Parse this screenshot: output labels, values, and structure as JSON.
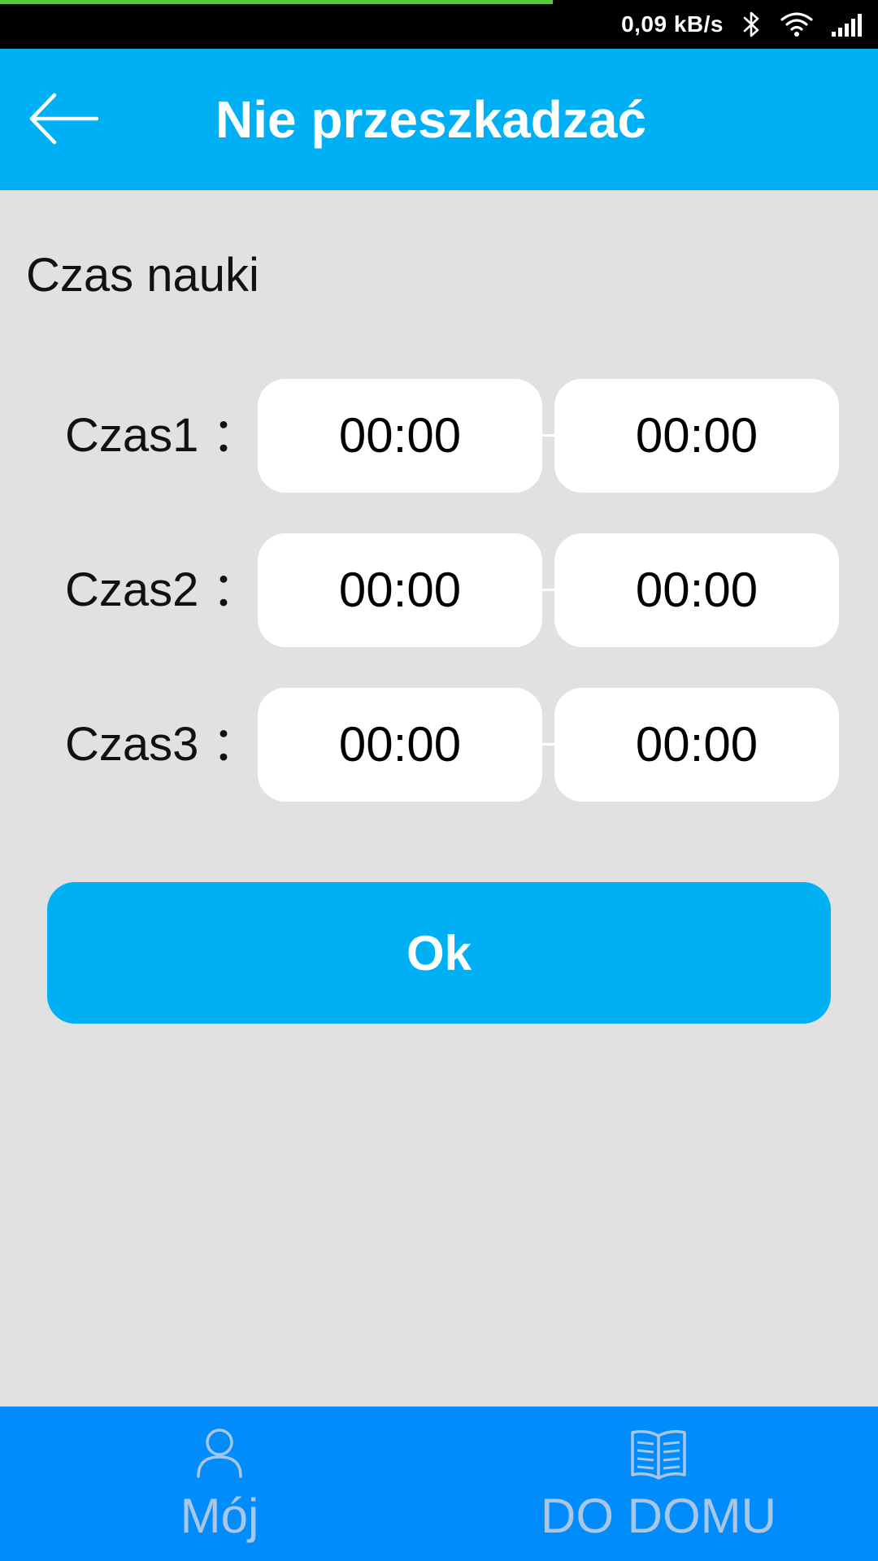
{
  "status_bar": {
    "net_speed": "0,09 kB/s",
    "progress": 0.63
  },
  "app_bar": {
    "title": "Nie przeszkadzać"
  },
  "section": {
    "title": "Czas nauki"
  },
  "time_slots": [
    {
      "label": "Czas1 ：",
      "start": "00:00",
      "end": "00:00"
    },
    {
      "label": "Czas2 ：",
      "start": "00:00",
      "end": "00:00"
    },
    {
      "label": "Czas3 ：",
      "start": "00:00",
      "end": "00:00"
    }
  ],
  "ok_button": {
    "label": "Ok"
  },
  "bottom_nav": {
    "items": [
      {
        "label": "Mój",
        "icon": "person-icon"
      },
      {
        "label": "DO DOMU",
        "icon": "book-icon"
      }
    ]
  },
  "colors": {
    "accent": "#00b0f4",
    "nav_bar": "#008cfc",
    "background": "#e1e1e1",
    "nav_label": "#a9c6e6"
  }
}
